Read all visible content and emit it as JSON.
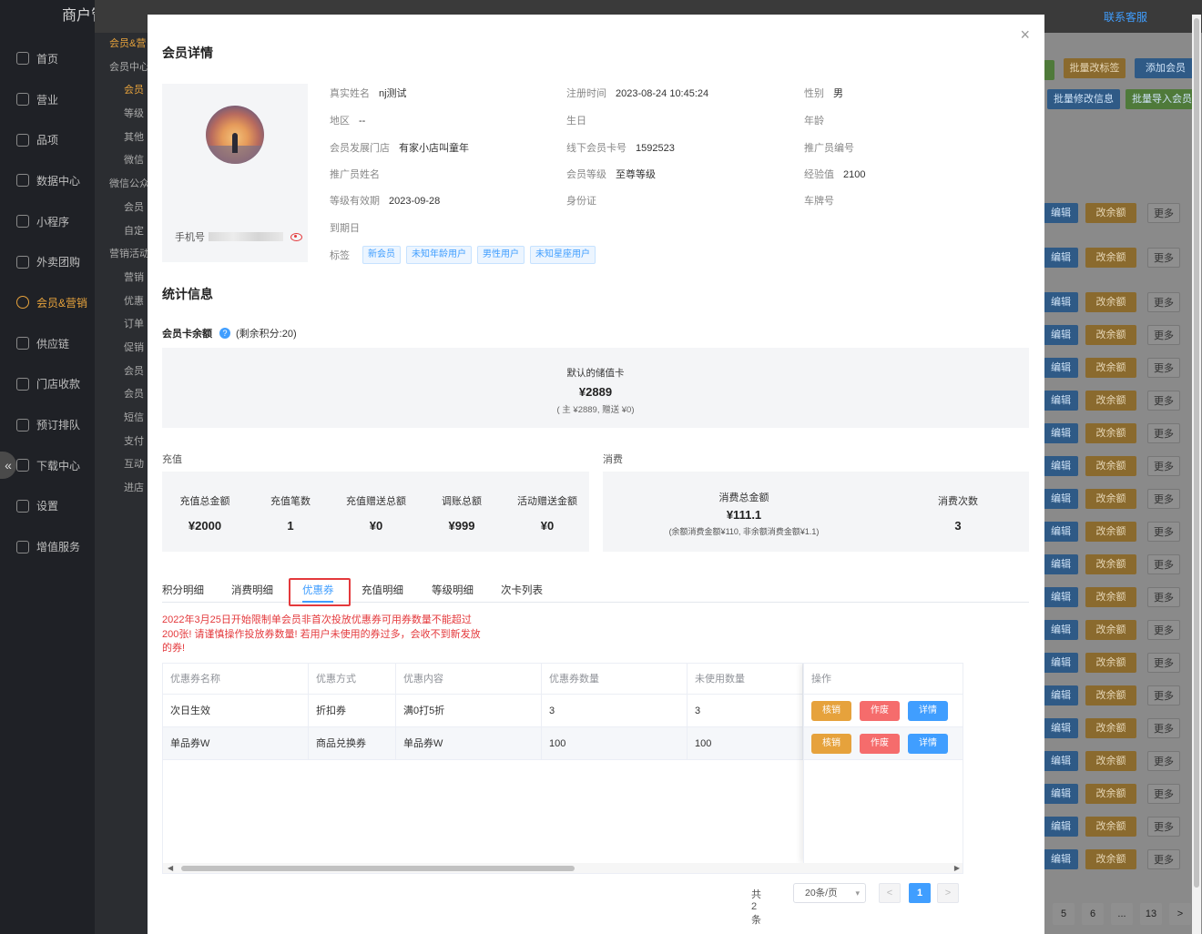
{
  "app": {
    "title": "商户管理平台",
    "nav": [
      "首页",
      "营业",
      "品项",
      "数据中心",
      "小程序",
      "外卖团购",
      "会员&营销",
      "供应链",
      "门店收款",
      "预订排队",
      "下载中心",
      "设置",
      "增值服务"
    ],
    "sub_nav": [
      {
        "label": "会员&营",
        "type": "grp"
      },
      {
        "label": "会员中心",
        "type": "grp"
      },
      {
        "label": "会员",
        "type": "cur"
      },
      {
        "label": "等级",
        "type": "item"
      },
      {
        "label": "其他",
        "type": "item"
      },
      {
        "label": "微信",
        "type": "item"
      },
      {
        "label": "微信公众",
        "type": "grp"
      },
      {
        "label": "会员",
        "type": "item"
      },
      {
        "label": "自定",
        "type": "item"
      },
      {
        "label": "营销活动",
        "type": "grp"
      },
      {
        "label": "营销",
        "type": "item"
      },
      {
        "label": "优惠",
        "type": "item"
      },
      {
        "label": "订单",
        "type": "item"
      },
      {
        "label": "促销",
        "type": "item"
      },
      {
        "label": "会员",
        "type": "item"
      },
      {
        "label": "会员",
        "type": "item"
      },
      {
        "label": "短信",
        "type": "item"
      },
      {
        "label": "支付",
        "type": "item"
      },
      {
        "label": "互动",
        "type": "item"
      },
      {
        "label": "进店",
        "type": "item"
      }
    ],
    "contact_service": "联系客服",
    "right_buttons": {
      "batch_tag": "批量改标签",
      "add_member": "添加会员",
      "batch_edit": "批量修改信息",
      "batch_import": "批量导入会员"
    },
    "row_actions": {
      "edit": "编辑",
      "change_balance": "改余额",
      "more": "更多"
    },
    "bg_pages": [
      "5",
      "6",
      "...",
      "13",
      ">"
    ]
  },
  "modal": {
    "title": "会员详情",
    "close": "×",
    "phone_label": "手机号",
    "info": [
      {
        "label": "真实姓名",
        "value": "nj测试"
      },
      {
        "label": "注册时间",
        "value": "2023-08-24 10:45:24"
      },
      {
        "label": "性别",
        "value": "男"
      },
      {
        "label": "地区",
        "value": "--"
      },
      {
        "label": "生日",
        "value": ""
      },
      {
        "label": "年龄",
        "value": ""
      },
      {
        "label": "会员发展门店",
        "value": "有家小店叫童年"
      },
      {
        "label": "线下会员卡号",
        "value": "1592523"
      },
      {
        "label": "推广员编号",
        "value": ""
      },
      {
        "label": "推广员姓名",
        "value": ""
      },
      {
        "label": "会员等级",
        "value": "至尊等级"
      },
      {
        "label": "经验值",
        "value": "2100"
      },
      {
        "label": "等级有效期",
        "value": "2023-09-28"
      },
      {
        "label": "身份证",
        "value": ""
      },
      {
        "label": "车牌号",
        "value": ""
      },
      {
        "label": "到期日",
        "value": ""
      }
    ],
    "tags_label": "标签",
    "tags": [
      "新会员",
      "未知年龄用户",
      "男性用户",
      "未知星座用户"
    ],
    "stats_title": "统计信息",
    "balance": {
      "label": "会员卡余额",
      "remaining": "(剩余积分:20)",
      "card_name": "默认的储值卡",
      "amount": "¥2889",
      "detail": "( 主 ¥2889, 赠送 ¥0)"
    },
    "recharge": {
      "label": "充值",
      "items": [
        {
          "k": "充值总金额",
          "v": "¥2000"
        },
        {
          "k": "充值笔数",
          "v": "1"
        },
        {
          "k": "充值赠送总额",
          "v": "¥0"
        },
        {
          "k": "调账总额",
          "v": "¥999"
        },
        {
          "k": "活动赠送金额",
          "v": "¥0"
        }
      ]
    },
    "consume": {
      "label": "消费",
      "total_label": "消费总金额",
      "total_value": "¥111.1",
      "total_note": "(余额消费金额¥110, 非余额消费金额¥1.1)",
      "count_label": "消费次数",
      "count_value": "3"
    },
    "tabs": [
      "积分明细",
      "消费明细",
      "优惠券",
      "充值明细",
      "等级明细",
      "次卡列表"
    ],
    "active_tab": 2,
    "warning": "2022年3月25日开始限制单会员非首次投放优惠券可用券数量不能超过200张! 请谨慎操作投放券数量! 若用户未使用的券过多，会收不到新发放的券!",
    "table": {
      "columns": [
        "优惠券名称",
        "优惠方式",
        "优惠内容",
        "优惠券数量",
        "未使用数量",
        "操作"
      ],
      "rows": [
        [
          "次日生效",
          "折扣券",
          "满0打5折",
          "3",
          "3"
        ],
        [
          "单品券W",
          "商品兑换券",
          "单品券W",
          "100",
          "100"
        ]
      ],
      "actions": [
        "核销",
        "作废",
        "详情"
      ]
    },
    "pagination": {
      "total": "共 2 条",
      "page_size": "20条/页",
      "current": "1",
      "prev": "<",
      "next": ">"
    }
  }
}
